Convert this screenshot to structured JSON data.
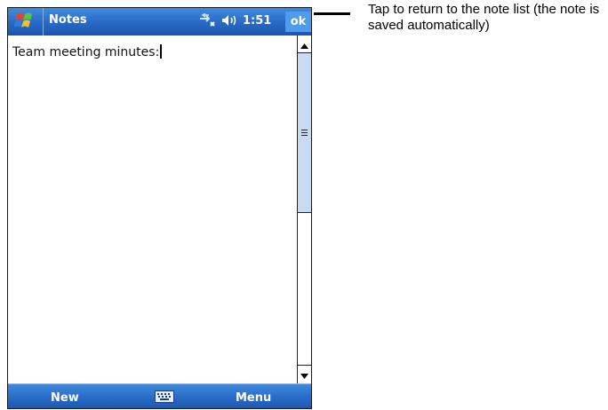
{
  "titlebar": {
    "app_title": "Notes",
    "time": "1:51",
    "ok_label": "ok",
    "icons": [
      "windows-start-icon",
      "connectivity-icon",
      "speaker-icon"
    ]
  },
  "editor": {
    "text": "Team meeting minutes:"
  },
  "menubar": {
    "new_label": "New",
    "menu_label": "Menu",
    "keyboard_icon": "keyboard-icon"
  },
  "callout": {
    "text": "Tap to return to the note list (the note is saved automatically)"
  },
  "colors": {
    "titlebar_blue": "#2769c5",
    "ok_button_blue": "#4f9bed",
    "scroll_thumb": "#c9daf5"
  }
}
